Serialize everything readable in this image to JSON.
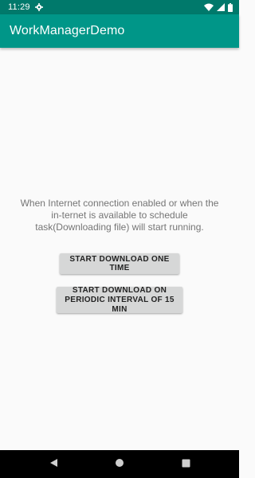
{
  "status_bar": {
    "time": "11:29",
    "icons": [
      "settings-icon",
      "wifi-icon",
      "signal-icon",
      "battery-icon"
    ]
  },
  "app_bar": {
    "title": "WorkManagerDemo",
    "color": "#009688",
    "status_color": "#00796b"
  },
  "main": {
    "info_text": "When Internet connection enabled or when the in-ternet is available to schedule task(Downloading file) will start running.",
    "buttons": {
      "one_time": "START DOWNLOAD ONE TIME",
      "periodic": "START DOWNLOAD ON PERIODIC INTERVAL OF 15 MIN"
    }
  },
  "nav_bar": {
    "icons": [
      "back-icon",
      "home-icon",
      "recents-icon"
    ]
  }
}
